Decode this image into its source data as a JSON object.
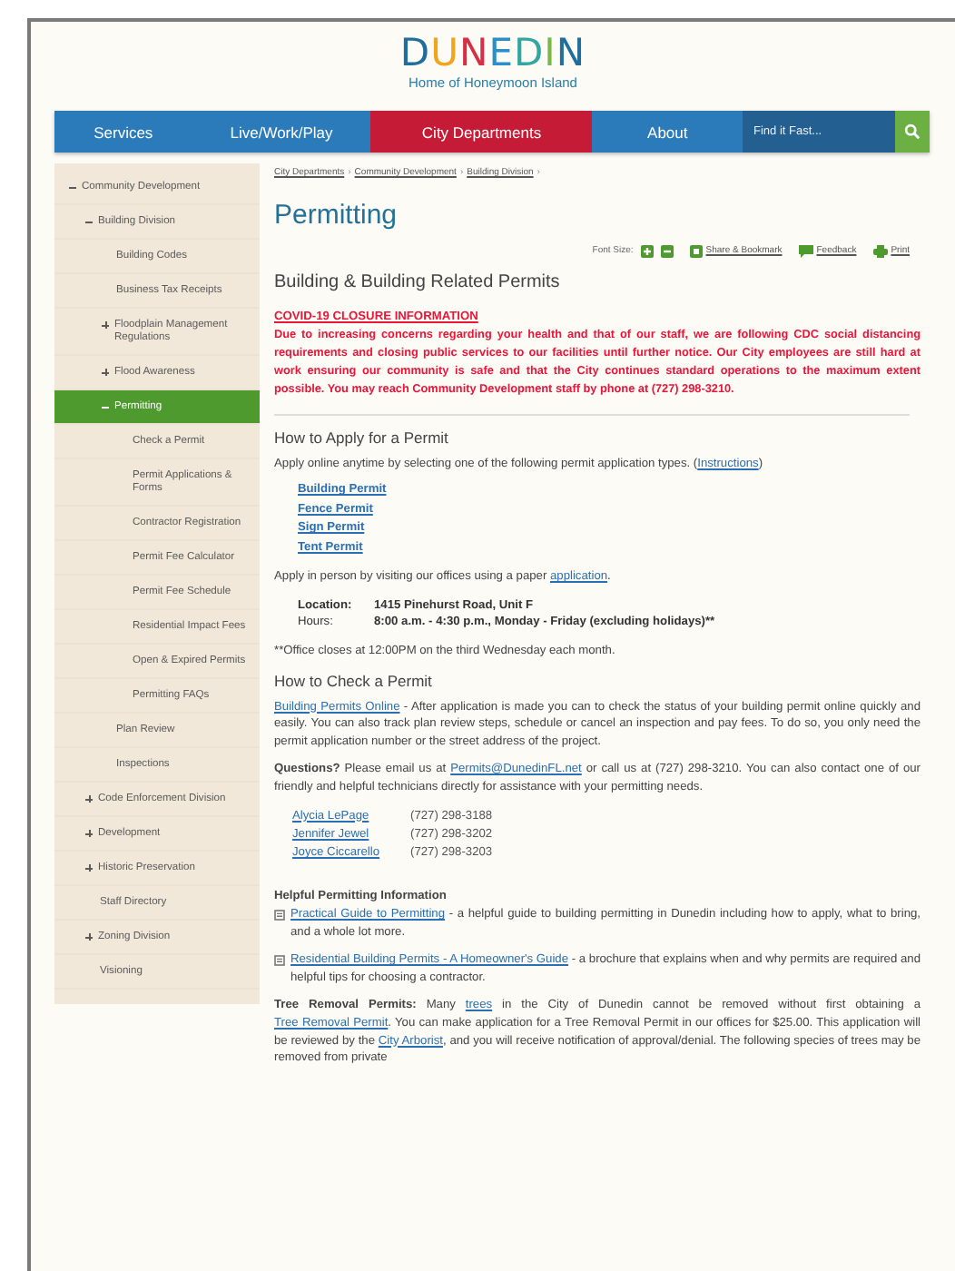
{
  "logo": {
    "name": "DUNEDIN",
    "tagline": "Home of Honeymoon Island"
  },
  "nav": {
    "items": [
      {
        "label": "Services",
        "selected": false
      },
      {
        "label": "Live/Work/Play",
        "selected": false
      },
      {
        "label": "City Departments",
        "selected": true
      },
      {
        "label": "About",
        "selected": false
      }
    ],
    "search": {
      "placeholder": "Find it Fast..."
    }
  },
  "sidebar": {
    "items": [
      {
        "label": "Community Development",
        "expanded": true,
        "selected": false,
        "children": [
          {
            "label": "Building Division",
            "expanded": true,
            "selected": false,
            "children": [
              {
                "label": "Building Codes",
                "selected": false
              },
              {
                "label": "Business Tax Receipts",
                "selected": false
              },
              {
                "label": "Floodplain Management Regulations",
                "expanded": false,
                "selected": false
              },
              {
                "label": "Flood Awareness",
                "expanded": false,
                "selected": false
              },
              {
                "label": "Permitting",
                "expanded": true,
                "selected": true,
                "children": [
                  {
                    "label": "Check a Permit",
                    "selected": false
                  },
                  {
                    "label": "Permit Applications & Forms",
                    "selected": false
                  },
                  {
                    "label": "Contractor Registration",
                    "selected": false
                  },
                  {
                    "label": "Permit Fee Calculator",
                    "selected": false
                  },
                  {
                    "label": "Permit Fee Schedule",
                    "selected": false
                  },
                  {
                    "label": "Residential Impact Fees",
                    "selected": false
                  },
                  {
                    "label": "Open & Expired Permits",
                    "selected": false
                  },
                  {
                    "label": "Permitting FAQs",
                    "selected": false
                  }
                ]
              },
              {
                "label": "Plan Review",
                "selected": false
              },
              {
                "label": "Inspections",
                "selected": false
              }
            ]
          },
          {
            "label": "Code Enforcement Division",
            "expanded": false,
            "selected": false
          },
          {
            "label": "Development",
            "expanded": false,
            "selected": false
          },
          {
            "label": "Historic Preservation",
            "expanded": false,
            "selected": false
          },
          {
            "label": "Staff Directory",
            "selected": false
          },
          {
            "label": "Zoning Division",
            "expanded": false,
            "selected": false
          },
          {
            "label": "Visioning",
            "selected": false
          }
        ]
      }
    ]
  },
  "breadcrumb": {
    "separator": "›",
    "items": [
      "City Departments",
      "Community Development",
      "Building Division"
    ]
  },
  "page_title": "Permitting",
  "tools": {
    "font_size_label": "Font Size:",
    "links": [
      {
        "label": "Share & Bookmark",
        "kind": "share"
      },
      {
        "label": "Feedback",
        "kind": "feedback"
      },
      {
        "label": "Print",
        "kind": "print"
      }
    ]
  },
  "content": [
    {
      "kind": "heading",
      "text": "Building & Building Related Permits"
    },
    {
      "kind": "alert_heading",
      "text": "COVID-19 CLOSURE INFORMATION"
    },
    {
      "kind": "alert",
      "text": "Due to increasing concerns regarding your health and that of our staff, we are following CDC social distancing requirements and closing public services to our facilities until further notice. Our City employees are still hard at work ensuring our community is safe and that the City continues standard operations to the maximum extent possible. You may reach Community Development staff by phone at (727) 298-3210."
    },
    {
      "kind": "subheading",
      "text": "How to Apply for a Permit"
    },
    {
      "kind": "paragraph",
      "parts": [
        {
          "kind": "plain",
          "text": "Apply online anytime by selecting one of the following permit application types. ("
        },
        {
          "kind": "link",
          "text": "Instructions"
        },
        {
          "kind": "plain",
          "text": ")"
        }
      ]
    },
    {
      "kind": "link_list",
      "items": [
        "Building Permit",
        "Fence Permit",
        "Sign Permit",
        "Tent Permit"
      ]
    },
    {
      "kind": "paragraph",
      "parts": [
        {
          "kind": "plain",
          "text": "Apply in person by visiting our offices using a paper "
        },
        {
          "kind": "link",
          "text": "application"
        },
        {
          "kind": "plain",
          "text": "."
        }
      ]
    },
    {
      "kind": "info_table",
      "rows": [
        {
          "label": "Location:",
          "value": "1415 Pinehurst Road, Unit F"
        },
        {
          "label": "Hours:",
          "value": "8:00 a.m. - 4:30 p.m., Monday - Friday (excluding holidays)**"
        }
      ]
    },
    {
      "kind": "note",
      "text": "**Office closes at 12:00PM on the third Wednesday each month."
    },
    {
      "kind": "subheading",
      "text": "How to Check a Permit"
    },
    {
      "kind": "paragraph",
      "parts": [
        {
          "kind": "link",
          "text": "Building Permits Online"
        },
        {
          "kind": "plain",
          "text": " - After application is made you can to check the status of your building permit online quickly and easily. You can also track plan review steps, schedule or cancel an inspection and pay fees. To do so, you only need the permit application number or the street address of the project."
        }
      ]
    },
    {
      "kind": "paragraph",
      "parts": [
        {
          "kind": "bold",
          "text": "Questions?"
        },
        {
          "kind": "plain",
          "text": " Please email us at "
        },
        {
          "kind": "link",
          "text": "Permits@DunedinFL.net"
        },
        {
          "kind": "plain",
          "text": " or call us at (727) 298-3210. You can also contact one of our friendly and helpful technicians directly for assistance with your permitting needs."
        }
      ]
    },
    {
      "kind": "contacts",
      "items": [
        {
          "name": "Alycia LePage",
          "phone": "(727) 298-3188"
        },
        {
          "name": "Jennifer Jewel",
          "phone": "(727) 298-3202"
        },
        {
          "name": "Joyce Ciccarello",
          "phone": "(727) 298-3203"
        }
      ]
    },
    {
      "kind": "bold_heading",
      "text": "Helpful Permitting Information"
    },
    {
      "kind": "document",
      "parts": [
        {
          "kind": "link",
          "text": "Practical Guide to Permitting"
        },
        {
          "kind": "plain",
          "text": " - a helpful guide to building permitting in Dunedin including how to apply, what to bring, and a whole lot more."
        }
      ]
    },
    {
      "kind": "document",
      "parts": [
        {
          "kind": "link",
          "text": "Residential Building Permits - A Homeowner's Guide"
        },
        {
          "kind": "plain",
          "text": " - a brochure that explains when and why permits are required and helpful tips for choosing a contractor."
        }
      ]
    },
    {
      "kind": "paragraph",
      "parts": [
        {
          "kind": "bold",
          "text": "Tree Removal Permits:"
        },
        {
          "kind": "plain",
          "text": " Many "
        },
        {
          "kind": "link",
          "text": "trees"
        },
        {
          "kind": "plain",
          "text": " in the City of Dunedin cannot be removed without first obtaining a "
        },
        {
          "kind": "link",
          "text": "Tree Removal Permit"
        },
        {
          "kind": "plain",
          "text": ". You can make application for a Tree Removal Permit in our offices for $25.00. This application will be reviewed by the "
        },
        {
          "kind": "link",
          "text": "City Arborist"
        },
        {
          "kind": "plain",
          "text": ", and you will receive notification of approval/denial. The following species of trees may be removed from private"
        }
      ]
    }
  ]
}
